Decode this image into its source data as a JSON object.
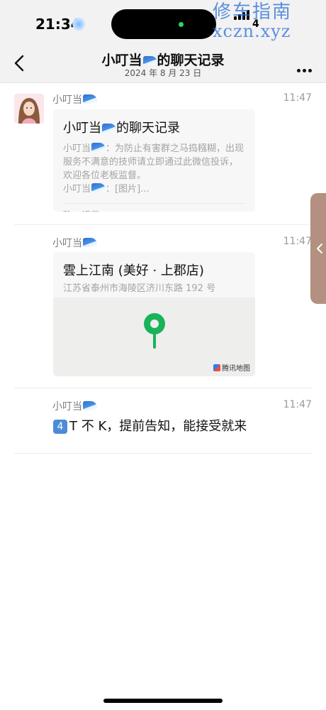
{
  "status_bar": {
    "time": "21:34",
    "battery": "4",
    "watermark_line1": "修车指南",
    "watermark_line2": "xczn.xyz"
  },
  "nav": {
    "title_prefix": "小叮当",
    "title_suffix": "的聊天记录",
    "date": "2024 年 8 月 23 日",
    "back_icon": "chevron-left-icon",
    "more_icon": "more-dots-icon"
  },
  "messages": [
    {
      "sender": "小叮当",
      "time": "11:47",
      "type": "chat-record",
      "card": {
        "title_prefix": "小叮当",
        "title_suffix": "的聊天记录",
        "line1_prefix": "小叮当",
        "line1_text": "：为防止有害群之马捣糨糊，出现服务不满意的技师请立即通过此微信投诉，欢迎各位老板监督。",
        "line2_prefix": "小叮当",
        "line2_text": "：[图片]...",
        "footer": "聊天记录"
      }
    },
    {
      "sender": "小叮当",
      "time": "11:47",
      "type": "location",
      "location": {
        "name": "雲上江南 (美好 · 上郡店)",
        "address": "江苏省泰州市海陵区济川东路 192 号",
        "map_provider": "腾讯地图"
      }
    },
    {
      "sender": "小叮当",
      "time": "11:47",
      "type": "text",
      "keycap": "4",
      "text": "T 不 K，提前告知，能接受就来"
    }
  ],
  "side_tab_icon": "chevron-left-icon",
  "colors": {
    "accent_green": "#19b35a",
    "nav_bg": "#f2f2f2",
    "card_bg": "#f7f7f7"
  }
}
